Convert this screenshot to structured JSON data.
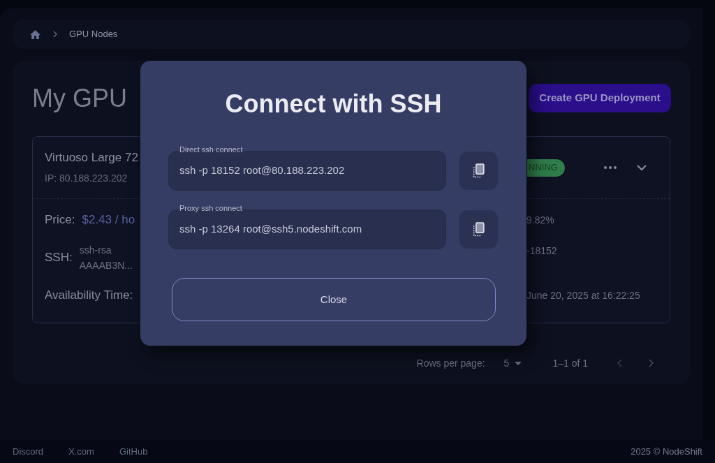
{
  "breadcrumb": {
    "current": "GPU Nodes"
  },
  "page_header": {
    "title": "My GPU",
    "create_button": "Create GPU Deployment"
  },
  "deployment": {
    "name": "Virtuoso Large 72",
    "ip": "IP: 80.188.223.202",
    "status": "NNING",
    "rows": [
      {
        "kind": "price",
        "label": "Price:",
        "value": "$2.43 / ho",
        "column_3": "9.82%"
      },
      {
        "kind": "key",
        "label": "SSH:",
        "lines": [
          "ssh-rsa",
          "AAAAB3N..."
        ],
        "column_3": "-18152"
      },
      {
        "kind": "plain",
        "label": "Availability Time:",
        "column_3": "June 20, 2025 at 16:22:25"
      }
    ]
  },
  "pagination": {
    "rows_per_page_label": "Rows per page:",
    "rows_per_page": "5",
    "range": "1–1 of 1"
  },
  "dialog": {
    "title": "Connect with SSH",
    "fields": [
      {
        "label": "Direct ssh connect",
        "value": "ssh -p 18152 root@80.188.223.202"
      },
      {
        "label": "Proxy ssh connect",
        "value": "ssh -p 13264 root@ssh5.nodeshift.com"
      }
    ],
    "close_button": "Close"
  },
  "footer": {
    "links": [
      "Discord",
      "X.com",
      "GitHub"
    ],
    "copyright": "2025 © NodeShift"
  }
}
